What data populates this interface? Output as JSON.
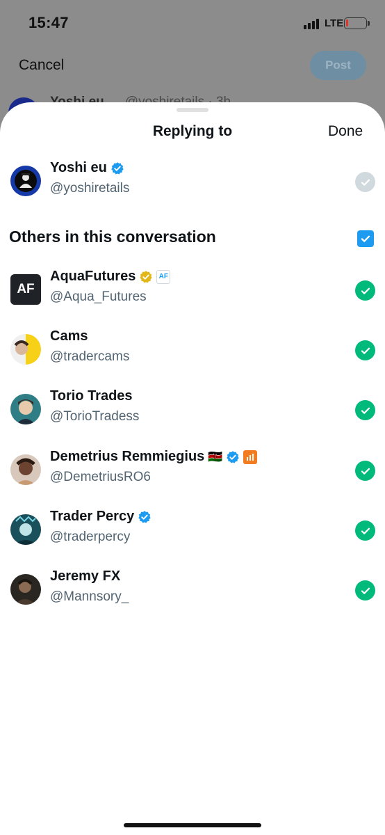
{
  "status_bar": {
    "time": "15:47",
    "network": "LTE"
  },
  "background": {
    "cancel_label": "Cancel",
    "post_label": "Post",
    "peek_name": "Yoshi eu",
    "peek_handle": "@yoshiretails · 3h"
  },
  "sheet": {
    "title": "Replying to",
    "done_label": "Done",
    "section_title": "Others in this conversation"
  },
  "primary": {
    "name": "Yoshi eu",
    "handle": "@yoshiretails",
    "verified": true
  },
  "others": [
    {
      "name": "AquaFutures",
      "handle": "@Aqua_Futures",
      "badge": "gold-verified",
      "affiliate_label": "AF",
      "avatar_label": "AF"
    },
    {
      "name": "Cams",
      "handle": "@tradercams"
    },
    {
      "name": "Torio Trades",
      "handle": "@TorioTradess"
    },
    {
      "name": "Demetrius Remmiegius",
      "handle": "@DemetriusRO6",
      "emoji": "🇰🇪",
      "badge": "blue-verified"
    },
    {
      "name": "Trader Percy",
      "handle": "@traderpercy",
      "badge": "blue-verified"
    },
    {
      "name": "Jeremy FX",
      "handle": "@Mannsory_"
    }
  ],
  "colors": {
    "accent": "#1d9bf0",
    "selected": "#00ba7c",
    "unselected": "#cfd9de",
    "gold": "#e2b719"
  }
}
